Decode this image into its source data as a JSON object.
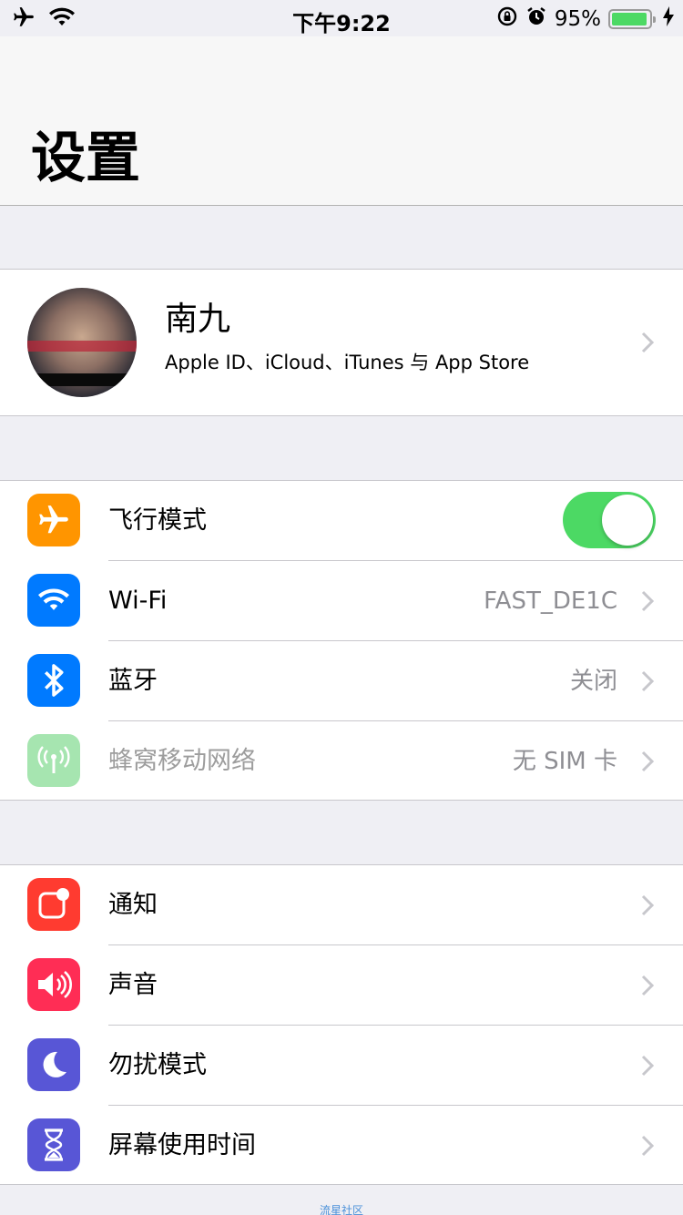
{
  "status_bar": {
    "time": "下午9:22",
    "battery_pct": "95%",
    "battery_level": 0.95,
    "icons": [
      "airplane-icon",
      "wifi-icon",
      "rotation-lock-icon",
      "alarm-icon",
      "battery-icon",
      "charging-bolt-icon"
    ]
  },
  "header": {
    "title": "设置"
  },
  "profile": {
    "name": "南九",
    "subtitle": "Apple ID、iCloud、iTunes 与 App Store"
  },
  "connectivity": [
    {
      "label": "飞行模式",
      "icon": "airplane-icon",
      "color": "#ff9500",
      "toggle_on": true
    },
    {
      "label": "Wi-Fi",
      "icon": "wifi-icon",
      "color": "#007aff",
      "value": "FAST_DE1C"
    },
    {
      "label": "蓝牙",
      "icon": "bluetooth-icon",
      "color": "#007aff",
      "value": "关闭"
    },
    {
      "label": "蜂窝移动网络",
      "icon": "cellular-antenna-icon",
      "color": "#a6e5b0",
      "value": "无 SIM 卡"
    }
  ],
  "system": [
    {
      "label": "通知",
      "icon": "notifications-icon",
      "color": "#ff3b30"
    },
    {
      "label": "声音",
      "icon": "speaker-icon",
      "color": "#ff2d55"
    },
    {
      "label": "勿扰模式",
      "icon": "moon-icon",
      "color": "#5856d6"
    },
    {
      "label": "屏幕使用时间",
      "icon": "hourglass-icon",
      "color": "#5856d6"
    }
  ],
  "watermark": "流星社区"
}
